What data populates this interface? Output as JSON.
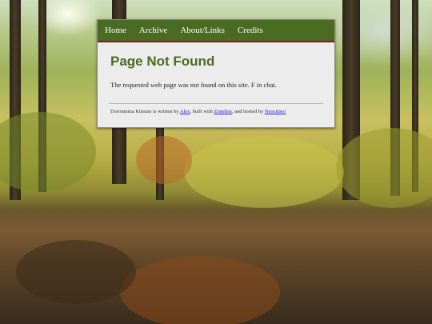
{
  "nav": {
    "items": [
      {
        "label": "Home"
      },
      {
        "label": "Archive"
      },
      {
        "label": "About/Links"
      },
      {
        "label": "Credits"
      }
    ]
  },
  "main": {
    "title": "Page Not Found",
    "message": "The requested web page was not found on this site. F in chat."
  },
  "footer": {
    "site_name": "Doromuma Kitsune",
    "text_written_by": " is written by ",
    "author_link": "Alex",
    "text_built_with": ", built with ",
    "builder_link": "Zonelets",
    "text_hosted_by": ", and hosted by ",
    "host_link": "Neocities!"
  },
  "colors": {
    "navbar_bg": "#4a6b22",
    "navbar_border": "#7a1f1f",
    "title_color": "#4a6b22",
    "link_color": "#1a1ad8",
    "panel_bg": "#ececec"
  }
}
